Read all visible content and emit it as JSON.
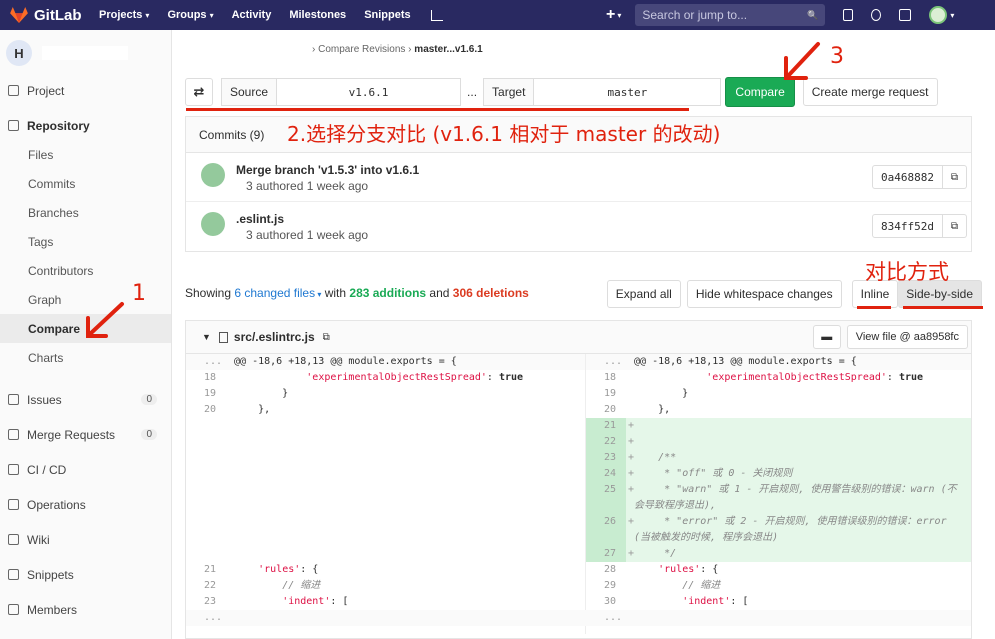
{
  "topbar": {
    "brand": "GitLab",
    "nav": [
      {
        "label": "Projects",
        "caret": "▾"
      },
      {
        "label": "Groups",
        "caret": "▾"
      },
      {
        "label": "Activity",
        "caret": ""
      },
      {
        "label": "Milestones",
        "caret": ""
      },
      {
        "label": "Snippets",
        "caret": ""
      }
    ],
    "plus": "+",
    "search_placeholder": "Search or jump to...",
    "search_icon": "🔍",
    "caret": "▾"
  },
  "sidebar": {
    "project_initial": "H",
    "items": [
      {
        "label": "Project",
        "icon": "home-icon"
      },
      {
        "label": "Repository",
        "icon": "book-icon"
      }
    ],
    "repo_sub": [
      "Files",
      "Commits",
      "Branches",
      "Tags",
      "Contributors",
      "Graph",
      "Compare",
      "Charts"
    ],
    "active_sub": "Compare",
    "lower": [
      {
        "label": "Issues",
        "badge": "0",
        "icon": "issues-icon"
      },
      {
        "label": "Merge Requests",
        "badge": "0",
        "icon": "merge-icon"
      },
      {
        "label": "CI / CD",
        "badge": "",
        "icon": "rocket-icon"
      },
      {
        "label": "Operations",
        "badge": "",
        "icon": "cloud-icon"
      },
      {
        "label": "Wiki",
        "badge": "",
        "icon": "book-icon"
      },
      {
        "label": "Snippets",
        "badge": "",
        "icon": "scissors-icon"
      },
      {
        "label": "Members",
        "badge": "",
        "icon": "users-icon"
      }
    ]
  },
  "breadcrumb": {
    "sep": "›",
    "parent": "Compare Revisions",
    "current": "master...v1.6.1"
  },
  "compare": {
    "swap": "⇄",
    "source_label": "Source",
    "source_value": "v1.6.1",
    "dots": "...",
    "target_label": "Target",
    "target_value": "master",
    "compare_button": "Compare",
    "mr_button": "Create merge request"
  },
  "commits": {
    "header": "Commits (9)",
    "items": [
      {
        "title": "Merge branch 'v1.5.3' into v1.6.1",
        "meta": "3 authored 1 week ago",
        "sha": "0a468882"
      },
      {
        "title": ".eslint.js",
        "meta": "3 authored 1 week ago",
        "sha": "834ff52d"
      }
    ]
  },
  "stats": {
    "showing": "Showing",
    "changed": "6 changed files",
    "with": "with",
    "additions": "283 additions",
    "and": "and",
    "deletions": "306 deletions",
    "expand_all": "Expand all",
    "hide_ws": "Hide whitespace changes",
    "inline": "Inline",
    "side_by_side": "Side-by-side"
  },
  "file": {
    "name": "src/.eslintrc.js",
    "view_file": "View file @ aa8958fc",
    "hunk": "@@ -18,6 +18,13 @@ module.exports = {",
    "fold": "...",
    "left": [
      {
        "n": "18",
        "t": "            'experimentalObjectRestSpread': true"
      },
      {
        "n": "19",
        "t": "        }"
      },
      {
        "n": "20",
        "t": "    },"
      },
      {
        "n": "21",
        "t": "    'rules': {"
      },
      {
        "n": "22",
        "t": "        // 缩进"
      },
      {
        "n": "23",
        "t": "        'indent': ["
      }
    ],
    "right": [
      {
        "n": "18",
        "t": "            'experimentalObjectRestSpread': true",
        "add": false
      },
      {
        "n": "19",
        "t": "        }",
        "add": false
      },
      {
        "n": "20",
        "t": "    },",
        "add": false
      },
      {
        "n": "21",
        "t": "",
        "add": true
      },
      {
        "n": "22",
        "t": "",
        "add": true
      },
      {
        "n": "23",
        "t": "    /**",
        "add": true
      },
      {
        "n": "24",
        "t": "     * \"off\" 或 0 - 关闭规则",
        "add": true
      },
      {
        "n": "25",
        "t": "     * \"warn\" 或 1 - 开启规则, 使用警告级别的错误：warn (不",
        "add": true
      },
      {
        "n": "",
        "t": "会导致程序退出),",
        "add": true
      },
      {
        "n": "26",
        "t": "     * \"error\" 或 2 - 开启规则, 使用错误级别的错误：error",
        "add": true
      },
      {
        "n": "",
        "t": "(当被触发的时候, 程序会退出)",
        "add": true
      },
      {
        "n": "27",
        "t": "     */",
        "add": true
      },
      {
        "n": "28",
        "t": "    'rules': {",
        "add": false
      },
      {
        "n": "29",
        "t": "        // 缩进",
        "add": false
      },
      {
        "n": "30",
        "t": "        'indent': [",
        "add": false
      }
    ]
  },
  "annotations": {
    "n1": "1",
    "n3": "3",
    "step2": "2.选择分支对比 (v1.6.1 相对于 master 的改动)",
    "view_mode": "对比方式"
  },
  "colors": {
    "topbar": "#292961",
    "green": "#1aaa55",
    "added_bg": "#e5f7e9",
    "added_ln_bg": "#c8ecd0",
    "annotation": "#e0220e"
  }
}
